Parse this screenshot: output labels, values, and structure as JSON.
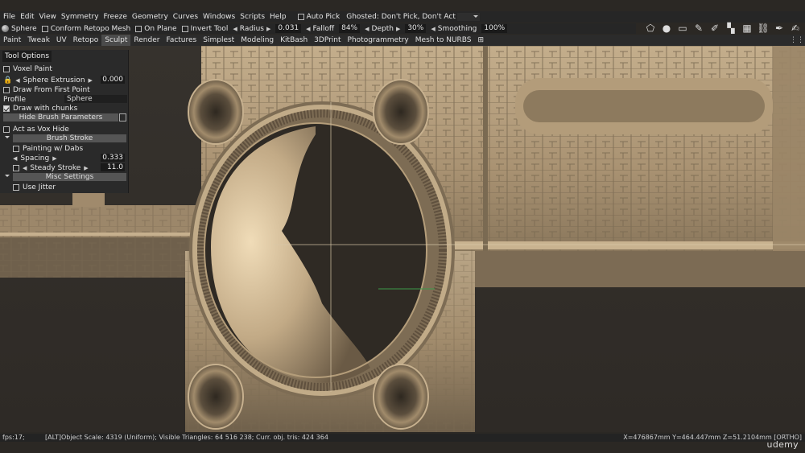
{
  "menu": {
    "items": [
      "File",
      "Edit",
      "View",
      "Symmetry",
      "Freeze",
      "Geometry",
      "Curves",
      "Windows",
      "Scripts",
      "Help"
    ],
    "auto_pick": "Auto Pick",
    "ghosted": "Ghosted: Don't Pick, Don't Act"
  },
  "toolbar": {
    "primitive": "Sphere",
    "conform": "Conform Retopo Mesh",
    "on_plane": "On Plane",
    "invert": "Invert Tool",
    "radius_label": "Radius",
    "radius_value": "0.031",
    "falloff_label": "Falloff",
    "falloff_value": "84%",
    "depth_label": "Depth",
    "depth_value": "30%",
    "smoothing_label": "Smoothing",
    "smoothing_value": "100%"
  },
  "rooms": {
    "tabs": [
      "Paint",
      "Tweak",
      "UV",
      "Retopo",
      "Sculpt",
      "Render",
      "Factures",
      "Simplest",
      "Modeling",
      "KitBash",
      "3DPrint",
      "Photogrammetry",
      "Mesh to NURBS"
    ],
    "active": "Sculpt"
  },
  "tool_options": {
    "title": "Tool Options",
    "voxel_paint": "Voxel Paint",
    "sphere_extrusion": "Sphere Extrusion",
    "sphere_extrusion_value": "0.000",
    "draw_from_first_point": "Draw From First Point",
    "profile_label": "Profile",
    "profile_value": "Sphere",
    "draw_with_chunks": "Draw with chunks",
    "hide_brush_parameters": "Hide Brush Parameters",
    "act_as_vox_hide": "Act as Vox Hide",
    "brush_stroke": "Brush Stroke",
    "painting_w_dabs": "Painting w/ Dabs",
    "spacing_label": "Spacing",
    "spacing_value": "0.333",
    "steady_stroke_label": "Steady Stroke",
    "steady_stroke_value": "11.0",
    "misc_settings": "Misc Settings",
    "use_jitter": "Use Jitter"
  },
  "status": {
    "fps": "fps:17;",
    "info": "[ALT]Object Scale: 4319 (Uniform); Visible Triangles: 64 516 238; Curr. obj. tris: 424 364",
    "coords": "X=476867mm  Y=464.447mm  Z=51.2104mm  [ORTHO]"
  },
  "watermark": "udemy",
  "icons": [
    "polygon-select-icon",
    "sphere-icon",
    "rectangle-select-icon",
    "pen-tool-icon",
    "brush-icon",
    "checker-icon",
    "grid-icon",
    "link-icon",
    "eyedropper-icon",
    "brush-settings-icon"
  ]
}
